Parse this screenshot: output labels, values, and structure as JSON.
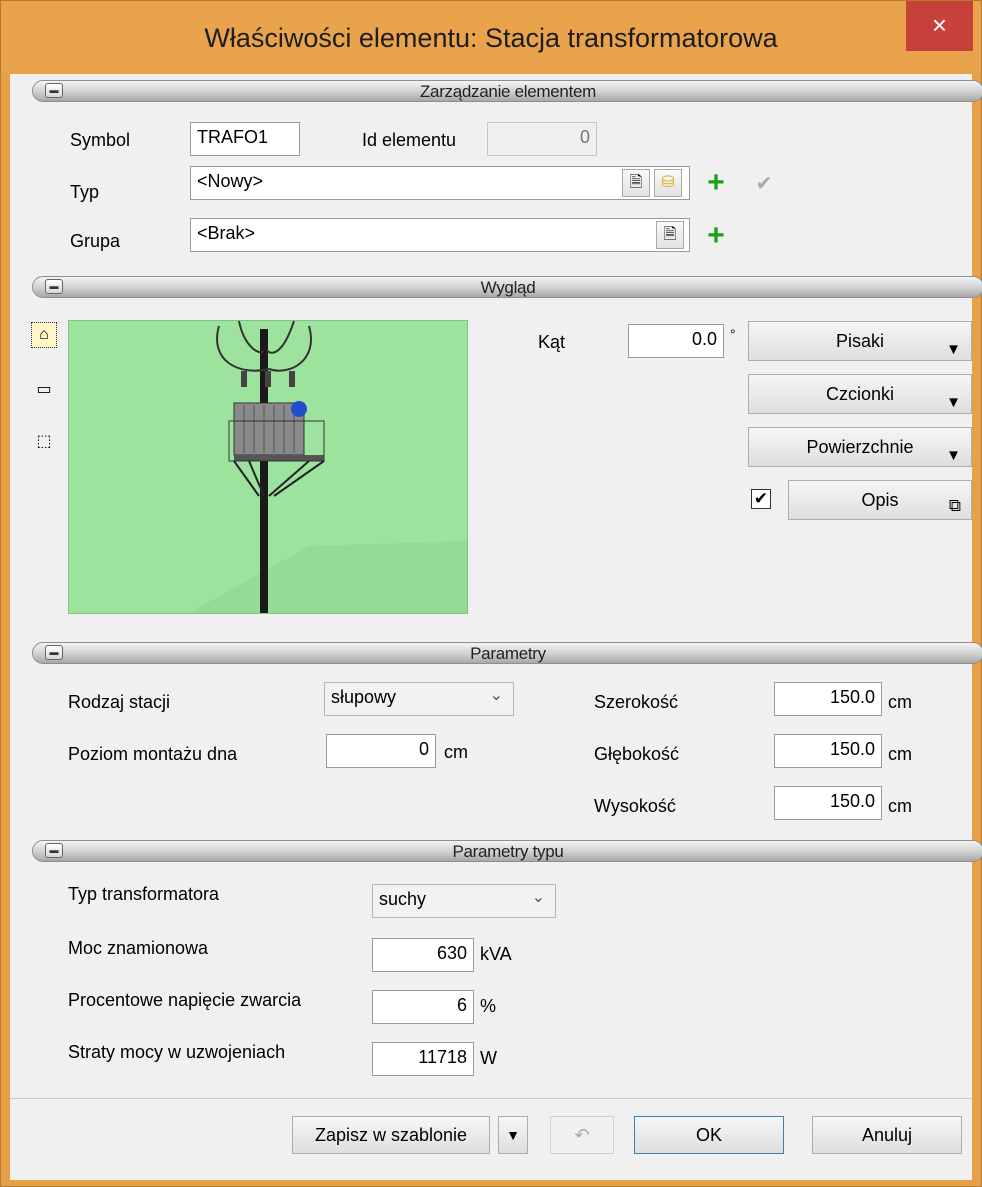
{
  "window": {
    "title": "Właściwości elementu: Stacja transformatorowa",
    "close_glyph": "×"
  },
  "sections": {
    "management": "Zarządzanie elementem",
    "appearance": "Wygląd",
    "parameters": "Parametry",
    "type_parameters": "Parametry typu"
  },
  "management": {
    "symbol_label": "Symbol",
    "symbol_value": "TRAFO1",
    "id_label": "Id elementu",
    "id_value": "0",
    "type_label": "Typ",
    "type_value": "<Nowy>",
    "group_label": "Grupa",
    "group_value": "<Brak>"
  },
  "appearance": {
    "angle_label": "Kąt",
    "angle_value": "0.0",
    "angle_unit": "°",
    "pens": "Pisaki",
    "fonts": "Czcionki",
    "surfaces": "Powierzchnie",
    "description": "Opis",
    "description_checked": "✔",
    "preview_bg": "#9de39e"
  },
  "parameters": {
    "station_type_label": "Rodzaj stacji",
    "station_type_value": "słupowy",
    "mount_level_label": "Poziom montażu dna",
    "mount_level_value": "0",
    "mount_level_unit": "cm",
    "width_label": "Szerokość",
    "width_value": "150.0",
    "width_unit": "cm",
    "depth_label": "Głębokość",
    "depth_value": "150.0",
    "depth_unit": "cm",
    "height_label": "Wysokość",
    "height_value": "150.0",
    "height_unit": "cm"
  },
  "type_parameters": {
    "transformer_type_label": "Typ transformatora",
    "transformer_type_value": "suchy",
    "rated_power_label": "Moc znamionowa",
    "rated_power_value": "630",
    "rated_power_unit": "kVA",
    "short_circuit_label": "Procentowe napięcie zwarcia",
    "short_circuit_value": "6",
    "short_circuit_unit": "%",
    "losses_label": "Straty mocy w uzwojeniach",
    "losses_value": "11718",
    "losses_unit": "W"
  },
  "footer": {
    "save_template": "Zapisz w szablonie",
    "ok": "OK",
    "cancel": "Anuluj"
  }
}
